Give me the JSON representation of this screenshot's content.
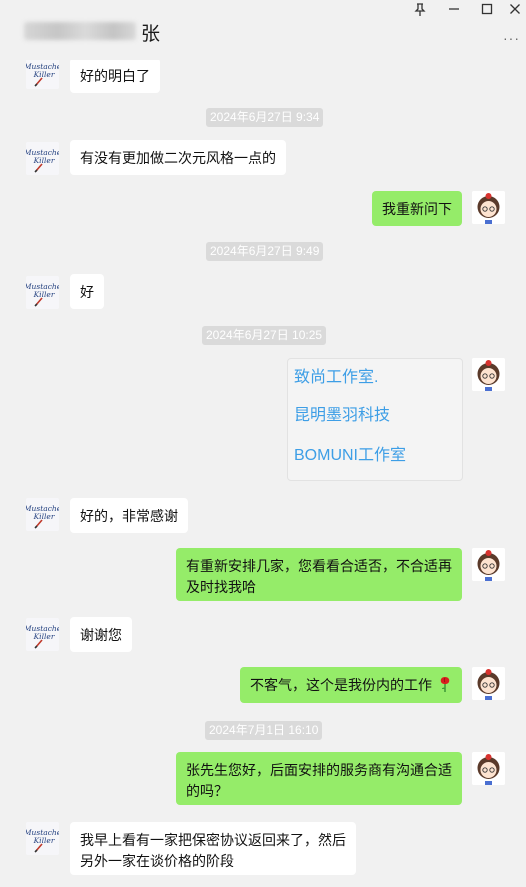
{
  "window": {
    "title_suffix": "张",
    "controls": {
      "pin": "📌",
      "minimize": "—",
      "maximize": "☐",
      "close": "✕"
    },
    "more": "···"
  },
  "avatars": {
    "contact_text": "Mustache Killer",
    "self_icon": "cartoon-girl-avatar"
  },
  "messages": [
    {
      "type": "text",
      "side": "theirs",
      "text": "好的明白了"
    },
    {
      "type": "timestamp",
      "text": "2024年6月27日 9:34"
    },
    {
      "type": "text",
      "side": "theirs",
      "text": "有没有更加做二次元风格一点的"
    },
    {
      "type": "text",
      "side": "mine",
      "text": "我重新问下"
    },
    {
      "type": "timestamp",
      "text": "2024年6月27日 9:49"
    },
    {
      "type": "text",
      "side": "theirs",
      "text": "好"
    },
    {
      "type": "timestamp",
      "text": "2024年6月27日 10:25"
    },
    {
      "type": "card",
      "side": "mine",
      "lines": [
        "致尚工作室.",
        "昆明墨羽科技",
        "BOMUNI工作室"
      ]
    },
    {
      "type": "text",
      "side": "theirs",
      "text": "好的，非常感谢"
    },
    {
      "type": "text",
      "side": "mine",
      "text": "有重新安排几家，您看看合适否，不合适再及时找我哈"
    },
    {
      "type": "text",
      "side": "theirs",
      "text": "谢谢您"
    },
    {
      "type": "text",
      "side": "mine",
      "text": "不客气，这个是我份内的工作",
      "emoji": "rose-icon"
    },
    {
      "type": "timestamp",
      "text": "2024年7月1日 16:10"
    },
    {
      "type": "text",
      "side": "mine",
      "text": "张先生您好，后面安排的服务商有沟通合适的吗？"
    },
    {
      "type": "text",
      "side": "theirs",
      "text": "我早上看有一家把保密协议返回来了，然后另外一家在谈价格的阶段"
    }
  ],
  "colors": {
    "my_bubble": "#95ec69",
    "their_bubble": "#ffffff",
    "background": "#f1f1f1",
    "timestamp_bg": "#dadada",
    "card_text": "#3d9ee6"
  }
}
